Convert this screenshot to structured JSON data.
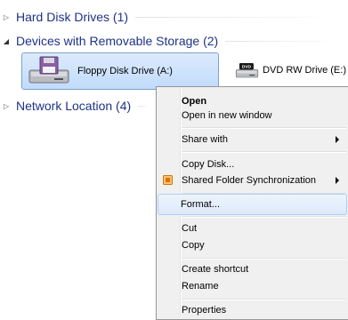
{
  "groups": [
    {
      "title": "Hard Disk Drives (1)",
      "expanded": false
    },
    {
      "title": "Devices with Removable Storage (2)",
      "expanded": true
    },
    {
      "title": "Network Location (4)",
      "expanded": false
    }
  ],
  "drives": [
    {
      "label": "Floppy Disk Drive (A:)",
      "icon": "floppy-drive-icon",
      "selected": true
    },
    {
      "label": "DVD RW Drive (E:)",
      "icon": "dvd-drive-icon",
      "badge": "DVD",
      "selected": false
    }
  ],
  "context_menu": {
    "items": [
      {
        "label": "Open",
        "bold": true
      },
      {
        "label": "Open in new window"
      },
      {
        "label": "Share with",
        "submenu": true
      },
      {
        "label": "Copy Disk..."
      },
      {
        "label": "Shared Folder Synchronization",
        "submenu": true,
        "icon": "sync-icon"
      },
      {
        "label": "Format...",
        "hover": true
      },
      {
        "label": "Cut"
      },
      {
        "label": "Copy"
      },
      {
        "label": "Create shortcut"
      },
      {
        "label": "Rename"
      },
      {
        "label": "Properties"
      }
    ]
  },
  "colors": {
    "group_title": "#1e3287",
    "selection": "#c1dbfc",
    "menu_bg": "#f0f0f0",
    "sync_icon": "#f0a030"
  }
}
